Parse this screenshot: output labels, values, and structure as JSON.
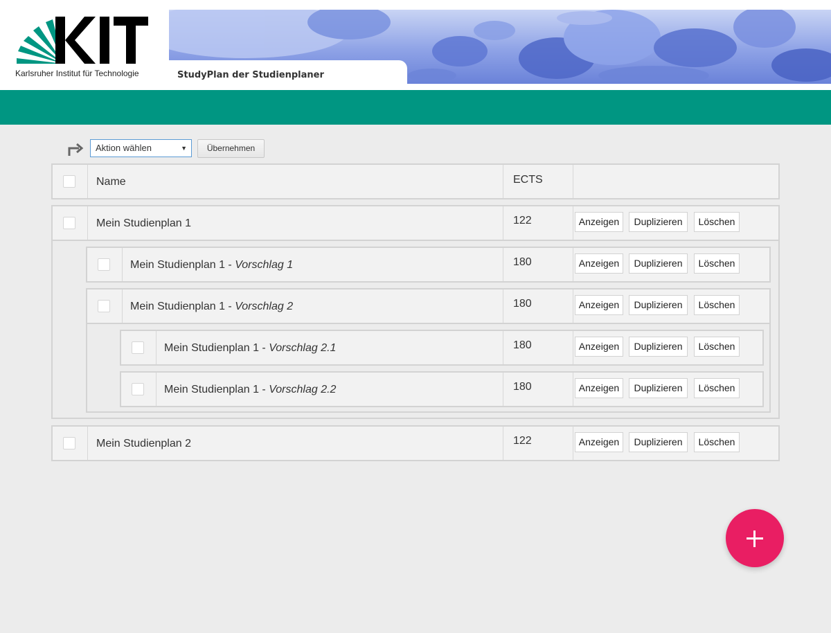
{
  "header": {
    "logo_text": "Karlsruher Institut für Technologie",
    "title": "StudyPlan der Studienplaner"
  },
  "bulk": {
    "selected_action": "Aktion wählen",
    "apply_label": "Übernehmen"
  },
  "table": {
    "col_name": "Name",
    "col_ects": "ECTS"
  },
  "buttons": {
    "show": "Anzeigen",
    "duplicate": "Duplizieren",
    "delete": "Löschen"
  },
  "plans": [
    {
      "name": "Mein Studienplan 1",
      "ects": "122"
    },
    {
      "name": "Mein Studienplan 1 - ",
      "suffix": "Vorschlag 1",
      "ects": "180"
    },
    {
      "name": "Mein Studienplan 1 - ",
      "suffix": "Vorschlag 2",
      "ects": "180"
    },
    {
      "name": "Mein Studienplan 1 - ",
      "suffix": "Vorschlag 2.1",
      "ects": "180"
    },
    {
      "name": "Mein Studienplan 1 - ",
      "suffix": "Vorschlag 2.2",
      "ects": "180"
    },
    {
      "name": "Mein Studienplan 2",
      "ects": "122"
    }
  ],
  "colors": {
    "kit_green": "#009682",
    "fab": "#e91e63"
  },
  "icons": {
    "bulk_arrow": "arrow-turn-right-icon",
    "fab": "plus-icon"
  }
}
